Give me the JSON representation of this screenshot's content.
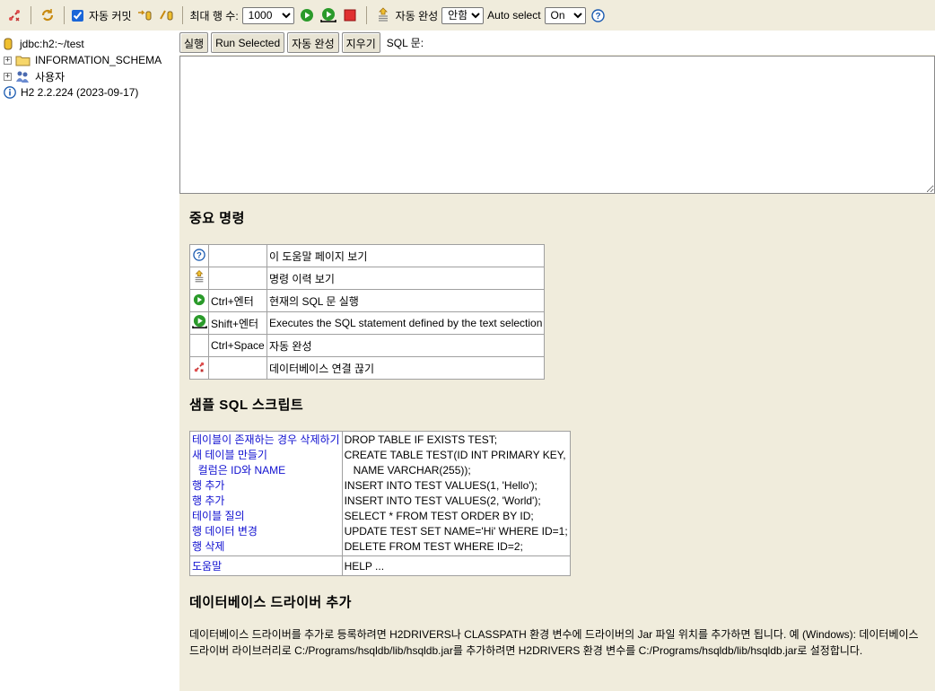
{
  "toolbar": {
    "autocommit_label": "자동 커밋",
    "max_rows_label": "최대 행 수:",
    "max_rows_value": "1000",
    "max_rows_options": [
      "1000"
    ],
    "autocomplete_label": "자동 완성",
    "autocomplete_value": "안함",
    "autocomplete_options": [
      "안함"
    ],
    "autoselect_label": "Auto select",
    "autoselect_value": "On",
    "autoselect_options": [
      "On"
    ]
  },
  "tree": {
    "connection": "jdbc:h2:~/test",
    "schema": "INFORMATION_SCHEMA",
    "users": "사용자",
    "version": "H2 2.2.224 (2023-09-17)"
  },
  "buttons": {
    "run": "실행",
    "run_selected": "Run Selected",
    "autocomplete": "자동 완성",
    "clear": "지우기",
    "sql_label": "SQL 문:"
  },
  "help": {
    "important_title": "중요 명령",
    "commands": [
      {
        "icon": "help-icon",
        "key": "",
        "desc": "이 도움말 페이지 보기"
      },
      {
        "icon": "history-icon",
        "key": "",
        "desc": "명령 이력 보기"
      },
      {
        "icon": "run-icon",
        "key": "Ctrl+엔터",
        "desc": "현재의 SQL 문 실행"
      },
      {
        "icon": "run-selected-icon",
        "key": "Shift+엔터",
        "desc": "Executes the SQL statement defined by the text selection"
      },
      {
        "icon": "",
        "key": "Ctrl+Space",
        "desc": "자동 완성"
      },
      {
        "icon": "disconnect-icon",
        "key": "",
        "desc": "데이터베이스 연결 끊기"
      }
    ],
    "sample_title": "샘플 SQL 스크립트",
    "sample_links": [
      "테이블이 존재하는 경우 삭제하기",
      "새 테이블 만들기",
      "  컬럼은 ID와 NAME",
      "행 추가",
      "행 추가",
      "테이블 질의",
      "행 데이터 변경",
      "행 삭제"
    ],
    "sample_sql": [
      "DROP TABLE IF EXISTS TEST;",
      "CREATE TABLE TEST(ID INT PRIMARY KEY,",
      "   NAME VARCHAR(255));",
      "INSERT INTO TEST VALUES(1, 'Hello');",
      "INSERT INTO TEST VALUES(2, 'World');",
      "SELECT * FROM TEST ORDER BY ID;",
      "UPDATE TEST SET NAME='Hi' WHERE ID=1;",
      "DELETE FROM TEST WHERE ID=2;"
    ],
    "help_link": "도움말",
    "help_sql": "HELP ...",
    "driver_title": "데이터베이스 드라이버 추가",
    "driver_text": "데이터베이스 드라이버를 추가로 등록하려면 H2DRIVERS나 CLASSPATH 환경 변수에 드라이버의 Jar 파일 위치를 추가하면 됩니다. 예 (Windows): 데이터베이스 드라이버 라이브러리로 C:/Programs/hsqldb/lib/hsqldb.jar를 추가하려면 H2DRIVERS 환경 변수를 C:/Programs/hsqldb/lib/hsqldb.jar로 설정합니다."
  }
}
